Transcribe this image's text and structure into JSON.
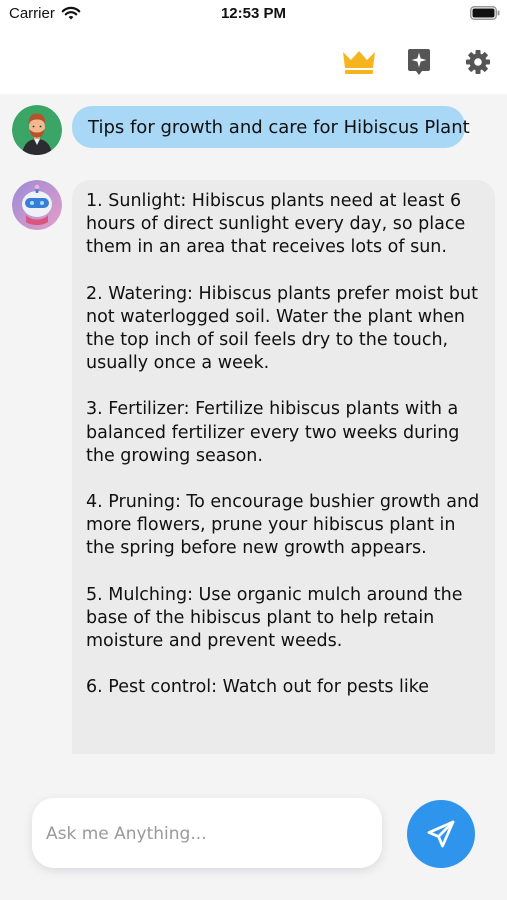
{
  "status_bar": {
    "carrier": "Carrier",
    "time": "12:53 PM"
  },
  "header": {
    "icons": [
      "crown-icon",
      "sparkle-badge-icon",
      "gear-icon"
    ],
    "crown_color": "#f6b51e",
    "icon_color": "#555555"
  },
  "chat": {
    "user_message": "Tips for growth and care for Hibiscus Plant",
    "bot_paragraphs": [
      "1. Sunlight: Hibiscus plants need at least 6 hours of direct sunlight every day, so place them in an area that receives lots of sun.",
      "2. Watering: Hibiscus plants prefer moist but not waterlogged soil. Water the plant when the top inch of soil feels dry to the touch, usually once a week.",
      "3. Fertilizer: Fertilize hibiscus plants with a balanced fertilizer every two weeks during the growing season.",
      "4. Pruning: To encourage bushier growth and more flowers, prune your hibiscus plant in the spring before new growth appears.",
      "5. Mulching: Use organic mulch around the base of the hibiscus plant to help retain moisture and prevent weeds.",
      "6. Pest control: Watch out for pests like"
    ],
    "user_bubble_color": "#a8d8f6",
    "bot_bubble_color": "#ebebec"
  },
  "composer": {
    "placeholder": "Ask me Anything...",
    "value": "",
    "send_color": "#2f95ec"
  }
}
